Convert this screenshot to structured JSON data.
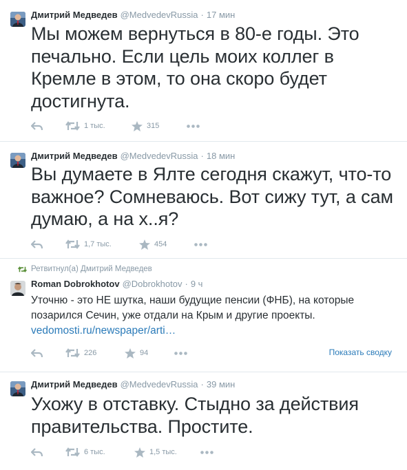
{
  "tweets": [
    {
      "name": "Дмитрий Медведев",
      "handle": "@MedvedevRussia",
      "time": "17 мин",
      "text": "Мы можем вернуться в 80-е годы. Это печально. Если цель моих коллег в Кремле в этом, то она скоро будет достигнута.",
      "retweets": "1 тыс.",
      "favorites": "315"
    },
    {
      "name": "Дмитрий Медведев",
      "handle": "@MedvedevRussia",
      "time": "18 мин",
      "text": "Вы думаете в Ялте сегодня скажут, что-то важное? Сомневаюсь. Вот сижу тут, а сам думаю, а на х..я?",
      "retweets": "1,7 тыс.",
      "favorites": "454"
    },
    {
      "retweeted_by": "Ретвитнул(а) Дмитрий Медведев",
      "name": "Roman Dobrokhotov",
      "handle": "@Dobrokhotov",
      "time": "9 ч",
      "text": "Уточню - это НЕ шутка, наши будущие пенсии (ФНБ), на которые позарился Сечин, уже отдали на Крым и другие проекты.",
      "link": "vedomosti.ru/newspaper/arti…",
      "retweets": "226",
      "favorites": "94",
      "summary": "Показать сводку"
    },
    {
      "name": "Дмитрий Медведев",
      "handle": "@MedvedevRussia",
      "time": "39 мин",
      "text": "Ухожу в отставку. Стыдно за действия правительства. Простите.",
      "retweets": "6 тыс.",
      "favorites": "1,5 тыс."
    }
  ],
  "icons": {
    "reply": "reply-icon",
    "retweet": "retweet-icon",
    "favorite": "star-icon",
    "more": "more-icon"
  },
  "colors": {
    "text": "#292f33",
    "muted": "#8899a6",
    "link": "#2b7bb9",
    "retweet_green": "#5c913b"
  },
  "separator": "·"
}
